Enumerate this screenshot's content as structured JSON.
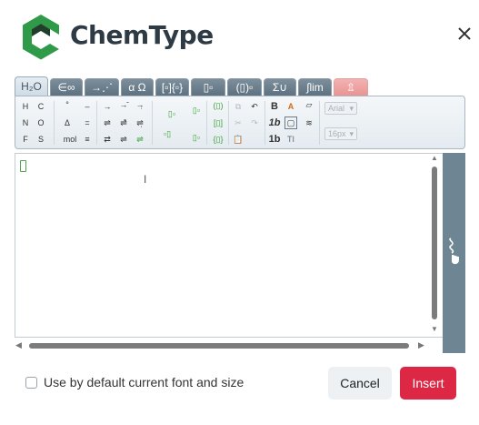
{
  "header": {
    "brand": "ChemType",
    "logo_colors": {
      "dark": "#1f3f2a",
      "green": "#2f9a47"
    },
    "close_icon": "close-icon"
  },
  "tabs": [
    {
      "label": "H₂O",
      "state": "active"
    },
    {
      "label": "∈∞",
      "state": "normal"
    },
    {
      "label": "→⋰",
      "state": "normal"
    },
    {
      "label": "α Ω",
      "state": "normal"
    },
    {
      "label": "[▫]{▫}",
      "state": "normal"
    },
    {
      "label": "▯▫",
      "state": "normal"
    },
    {
      "label": "(▯)▫",
      "state": "normal"
    },
    {
      "label": "Σ∪",
      "state": "normal"
    },
    {
      "label": "∫lim",
      "state": "normal"
    },
    {
      "label": "⇫",
      "state": "disabled"
    }
  ],
  "toolbar": {
    "elements": [
      "H",
      "C",
      "N",
      "O",
      "F",
      "S"
    ],
    "charge_symbols": [
      "°",
      "Δ",
      "mol"
    ],
    "bonds": [
      "–",
      "=",
      "≡"
    ],
    "arrows": [
      "→",
      "⇌",
      "⇄"
    ],
    "font_select": "Arial",
    "size_select": "16px",
    "format": {
      "bold": "B",
      "italic": "1b",
      "text_color": "A"
    }
  },
  "editor": {
    "content": ""
  },
  "footer": {
    "checkbox_label": "Use by default current font and size",
    "checkbox_checked": false,
    "cancel_label": "Cancel",
    "insert_label": "Insert"
  },
  "colors": {
    "accent": "#dc2745",
    "tab_bg": "#6d8190",
    "handwrite_panel": "#6e8593"
  }
}
